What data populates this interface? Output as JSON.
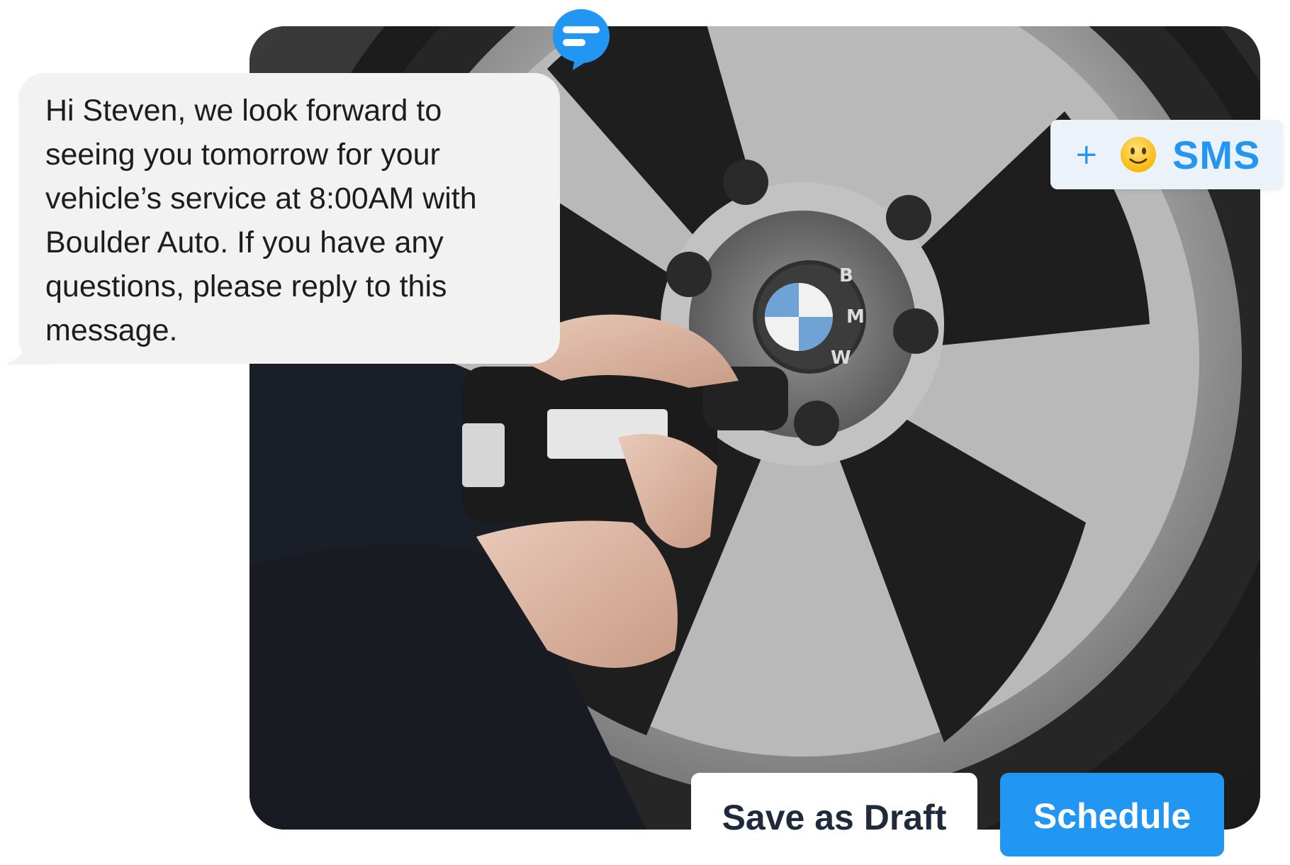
{
  "message": {
    "lines": [
      "Hi Steven, we look forward to",
      "seeing you tomorrow for your",
      "vehicle’s service at 8:00AM with",
      "Boulder Auto. If you have any",
      "questions, please reply to this",
      "message."
    ]
  },
  "composer": {
    "plus_symbol": "+",
    "emoji_icon": "smiley-face-icon",
    "channel_label": "SMS"
  },
  "actions": {
    "save_draft_label": "Save as Draft",
    "schedule_label": "Schedule"
  },
  "photo": {
    "badge_letters": [
      "B",
      "M",
      "W"
    ]
  },
  "colors": {
    "accent_blue": "#2196f3",
    "bubble_gray": "#f2f2f2",
    "chip_bg": "#ebf2f9",
    "draft_text": "#1f2a3c"
  }
}
